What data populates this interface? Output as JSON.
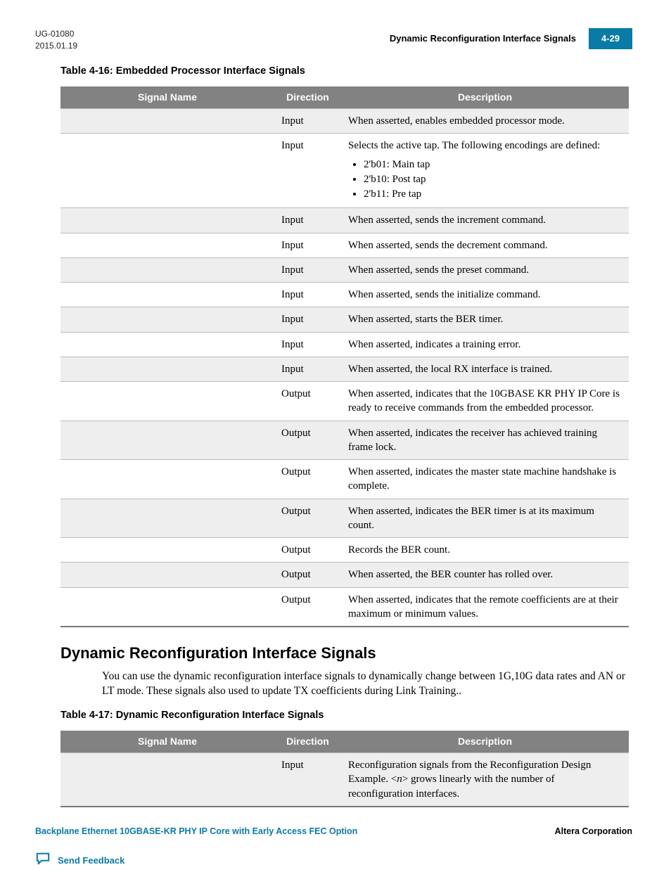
{
  "header": {
    "doc_id": "UG-01080",
    "date": "2015.01.19",
    "section_title": "Dynamic Reconfiguration Interface Signals",
    "page_num": "4-29"
  },
  "table1": {
    "caption": "Table 4-16: Embedded Processor Interface Signals",
    "headers": {
      "signal": "Signal Name",
      "direction": "Direction",
      "description": "Description"
    },
    "rows": [
      {
        "signal": "",
        "direction": "Input",
        "description": "When asserted, enables embedded processor mode."
      },
      {
        "signal": "",
        "direction": "Input",
        "desc_intro": "Selects the active tap. The following encodings are defined:",
        "bullets": [
          "2'b01: Main tap",
          "2'b10: Post tap",
          "2'b11: Pre tap"
        ]
      },
      {
        "signal": "",
        "direction": "Input",
        "description": "When asserted, sends the increment command."
      },
      {
        "signal": "",
        "direction": "Input",
        "description": "When asserted, sends the decrement command."
      },
      {
        "signal": "",
        "direction": "Input",
        "description": "When asserted, sends the preset command."
      },
      {
        "signal": "",
        "direction": "Input",
        "description": "When asserted, sends the initialize command."
      },
      {
        "signal": "",
        "direction": "Input",
        "description": "When asserted, starts the BER timer."
      },
      {
        "signal": "",
        "direction": "Input",
        "description": "When asserted, indicates a training error."
      },
      {
        "signal": "",
        "direction": "Input",
        "description": "When asserted, the local RX interface is trained."
      },
      {
        "signal": "",
        "direction": "Output",
        "description": "When asserted, indicates that the 10GBASE KR PHY IP Core is ready to receive commands from the embedded processor."
      },
      {
        "signal": "",
        "direction": "Output",
        "description": "When asserted, indicates the receiver has achieved training frame lock."
      },
      {
        "signal": "",
        "direction": "Output",
        "description": "When asserted, indicates the master state machine handshake is complete."
      },
      {
        "signal": "",
        "direction": "Output",
        "description": "When asserted, indicates the BER timer is at its maximum count."
      },
      {
        "signal": "",
        "direction": "Output",
        "description": "Records the BER count."
      },
      {
        "signal": "",
        "direction": "Output",
        "description": "When asserted, the BER counter has rolled over."
      },
      {
        "signal": "",
        "direction": "Output",
        "description": "When asserted, indicates that the remote coefficients are at their maximum or minimum values."
      }
    ]
  },
  "section": {
    "heading": "Dynamic Reconfiguration Interface Signals",
    "body": "You can use the dynamic reconfiguration interface signals to dynamically change between 1G,10G data rates and AN or LT mode. These signals also used to update TX coefficients during Link Training.."
  },
  "table2": {
    "caption": "Table 4-17: Dynamic Reconfiguration Interface Signals",
    "headers": {
      "signal": "Signal Name",
      "direction": "Direction",
      "description": "Description"
    },
    "rows": [
      {
        "signal": "",
        "direction": "Input",
        "desc_pre": "Reconfiguration signals from the Reconfiguration Design Example. <",
        "desc_var": "n",
        "desc_post": "> grows linearly with the number of reconfiguration interfaces."
      }
    ]
  },
  "footer": {
    "left": "Backplane Ethernet 10GBASE-KR PHY IP Core with Early Access FEC Option",
    "right": "Altera Corporation",
    "feedback": "Send Feedback"
  }
}
